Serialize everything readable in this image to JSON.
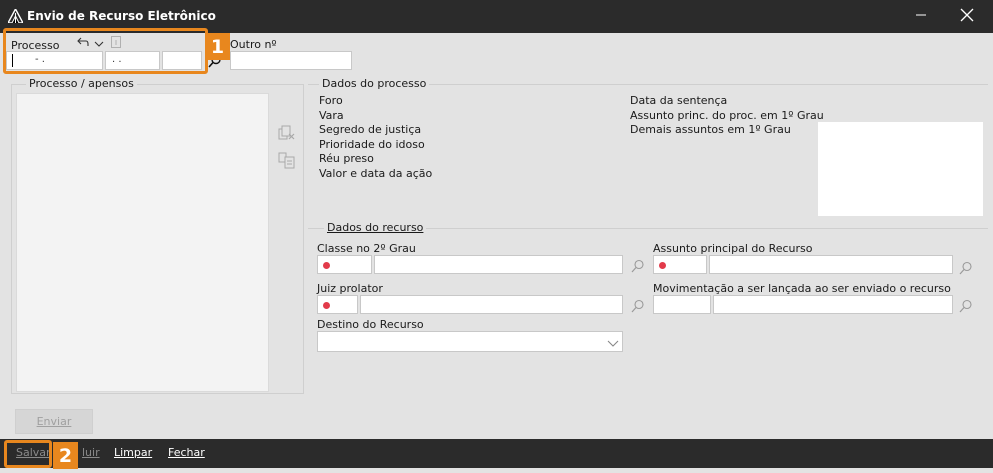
{
  "window": {
    "title": "Envio de Recurso Eletrônico"
  },
  "processo": {
    "label": "Processo",
    "field1": "-  .",
    "field2": ".  .",
    "outro_label": "Outro nº"
  },
  "apensos": {
    "legend": "Processo / apensos"
  },
  "dados_processo": {
    "legend": "Dados do processo",
    "left_labels": [
      "Foro",
      "Vara",
      "Segredo de justiça",
      "Prioridade do idoso",
      "Réu preso",
      "Valor e data da ação"
    ],
    "right_labels": [
      "Data da sentença",
      "Assunto princ. do proc. em 1º Grau",
      "Demais assuntos em 1º Grau"
    ]
  },
  "dados_recurso": {
    "legend": "Dados do recurso",
    "classe_label": "Classe no 2º Grau",
    "assunto_label": "Assunto principal do Recurso",
    "juiz_label": "Juiz prolator",
    "movimentacao_label": "Movimentação a ser lançada ao ser enviado o recurso",
    "destino_label": "Destino do Recurso"
  },
  "buttons": {
    "enviar": "Enviar",
    "salvar": "Salvar",
    "excluir": "luir",
    "limpar": "Limpar",
    "fechar": "Fechar"
  },
  "annotations": {
    "badge1": "1",
    "badge2": "2"
  },
  "colors": {
    "highlight": "#e8871e",
    "required": "#e23a4a",
    "bar": "#2b2b2b"
  },
  "icons": [
    "app-logo-icon",
    "minimize-icon",
    "close-icon",
    "undo-icon",
    "chevron-down-icon",
    "info-icon",
    "search-icon",
    "remove-attachment-icon",
    "attachment-icon"
  ]
}
